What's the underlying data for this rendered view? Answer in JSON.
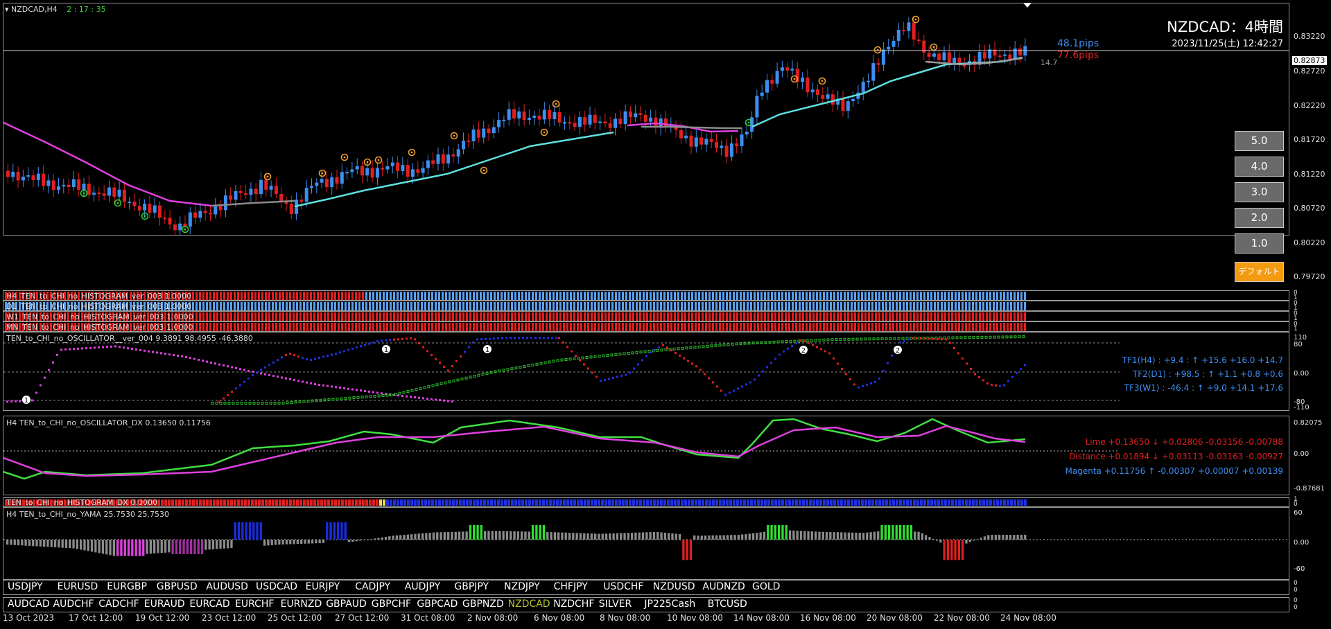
{
  "header": {
    "symbol_tf": "NZDCAD,H4",
    "countdown": "2 : 17 : 35"
  },
  "overlay": {
    "title": "NZDCAD：4時間",
    "datetime": "2023/11/25(土) 12:42:27",
    "pips_up": "48.1pips",
    "pips_down": "77.6pips",
    "small_val": "14.7"
  },
  "price_axis": [
    "0.83220",
    "0.82720",
    "0.82220",
    "0.81720",
    "0.81220",
    "0.80720",
    "0.80220",
    "0.79720"
  ],
  "current_price": "0.82873",
  "buttons": [
    "5.0",
    "4.0",
    "3.0",
    "2.0",
    "1.0",
    "デフォルト"
  ],
  "histograms": [
    "H4_TEN_to_CHI_no_HISTOGRAM_ver_003 1.0000",
    "D1_TEN_to_CHI_no_HISTOGRAM_ver_003 1.0000",
    "W1_TEN_to_CHI_no_HISTOGRAM_ver_003 1.0000",
    "MN_TEN_to_CHI_no_HISTOGRAM_ver_003 1.0000"
  ],
  "hist_scale": [
    "0",
    "1",
    "0",
    "1",
    "0",
    "1",
    "0",
    "1"
  ],
  "oscillator": {
    "label": "TEN_to_CHI_no_OSCILLATOR__ver_004 9.3891 98.4955 -46.3880",
    "scale": [
      "110",
      "80",
      "0.00",
      "-80",
      "-110"
    ],
    "tf1": "TF1(H4) : +9.4 : ↑ +15.6 +16.0 +14.7",
    "tf2": "TF2(D1) : +98.5 : ↑ +1.1 +0.8 +0.6",
    "tf3": "TF3(W1) : -46.4 : ↑ +9.0 +14.1 +17.6",
    "markers": [
      "1",
      "1",
      "1",
      "2",
      "2"
    ]
  },
  "dx": {
    "label": "H4 TEN_to_CHI_no_OSCILLATOR_DX 0.13650 0.11756",
    "scale": [
      "0.82075",
      "0.00",
      "-0.87681"
    ],
    "lime": "Lime +0.13650 ↓ +0.02806 -0.03156 -0.00788",
    "distance": "Distance +0.01894 ↓ +0.03113 -0.03163 -0.00927",
    "magenta": "Magenta +0.11756 ↑ -0.00307 +0.00007 +0.00139"
  },
  "histdx": {
    "label": "TEN_to_CHI_no_HISTOGRAM_DX 0.0000",
    "scale": [
      "1",
      "0"
    ]
  },
  "yama": {
    "label": "H4 TEN_to_CHI_no_YAMA 25.7530 25.7530",
    "scale": [
      "60",
      "0.00",
      "-60"
    ]
  },
  "symbols_row1": [
    "USDJPY",
    "EURUSD",
    "EURGBP",
    "GBPUSD",
    "AUDUSD",
    "USDCAD",
    "EURJPY",
    "CADJPY",
    "AUDJPY",
    "GBPJPY",
    "NZDJPY",
    "CHFJPY",
    "USDCHF",
    "NZDUSD",
    "AUDNZD",
    "GOLD"
  ],
  "symbols_row2": [
    "AUDCAD",
    "AUDCHF",
    "CADCHF",
    "EURAUD",
    "EURCAD",
    "EURCHF",
    "EURNZD",
    "GBPAUD",
    "GBPCHF",
    "GBPCAD",
    "GBPNZD",
    "NZDCAD",
    "NZDCHF",
    "SILVER",
    "JP225Cash",
    "BTCUSD"
  ],
  "symbol_scale": [
    "0",
    "0",
    "0",
    "0"
  ],
  "active_symbol": "NZDCAD",
  "dates": [
    "13 Oct 2023",
    "17 Oct 12:00",
    "19 Oct 12:00",
    "23 Oct 12:00",
    "25 Oct 12:00",
    "27 Oct 12:00",
    "31 Oct 08:00",
    "2 Nov 08:00",
    "6 Nov 08:00",
    "8 Nov 08:00",
    "10 Nov 08:00",
    "14 Nov 08:00",
    "16 Nov 08:00",
    "20 Nov 08:00",
    "22 Nov 08:00",
    "24 Nov 08:00"
  ],
  "colors": {
    "bull": "#3d8ef0",
    "bear": "#e02020",
    "ma_fast": "#5fe0e0",
    "ma_slow": "#e040e0",
    "osc_red": "#e02020",
    "osc_blue": "#2030e0",
    "osc_green": "#30c030",
    "lime": "#40e040",
    "magenta": "#e040e0",
    "button_orange": "#f39a10"
  }
}
